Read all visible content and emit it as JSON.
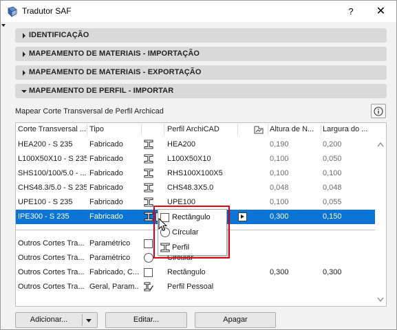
{
  "window": {
    "title": "Tradutor SAF",
    "help_label": "?",
    "close_label": "✕"
  },
  "sections": [
    {
      "label": "IDENTIFICAÇÃO",
      "expanded": false
    },
    {
      "label": "MAPEAMENTO DE MATERIAIS - IMPORTAÇÃO",
      "expanded": false
    },
    {
      "label": "MAPEAMENTO DE MATERIAIS - EXPORTAÇÃO",
      "expanded": false
    },
    {
      "label": "MAPEAMENTO DE PERFIL - IMPORTAR",
      "expanded": true
    }
  ],
  "panel": {
    "title": "Mapear Corte Transversal de Perfil Archicad",
    "info_icon": "info-icon"
  },
  "table": {
    "columns": [
      "Corte Transversal ...",
      "Tipo",
      "Perfil ArchiCAD",
      "Altura de N...",
      "Largura do ..."
    ],
    "rows": [
      {
        "section": "HEA200 - S 235",
        "type": "Fabricado",
        "icon": "i-beam-icon",
        "profile": "HEA200",
        "height": "0,190",
        "width": "0,200"
      },
      {
        "section": "L100X50X10 - S 235",
        "type": "Fabricado",
        "icon": "i-beam-icon",
        "profile": "L100X50X10",
        "height": "0,100",
        "width": "0,050"
      },
      {
        "section": "SHS100/100/5.0 - ...",
        "type": "Fabricado",
        "icon": "i-beam-icon",
        "profile": "RHS100X100X5",
        "height": "0,100",
        "width": "0,100"
      },
      {
        "section": "CHS48.3/5.0 - S 235",
        "type": "Fabricado",
        "icon": "i-beam-icon",
        "profile": "CHS48.3X5.0",
        "height": "0,048",
        "width": "0,048"
      },
      {
        "section": "UPE100 - S 235",
        "type": "Fabricado",
        "icon": "i-beam-icon",
        "profile": "UPE100",
        "height": "0,100",
        "width": "0,055"
      },
      {
        "section": "IPE300 - S 235",
        "type": "Fabricado",
        "icon": "i-beam-icon",
        "profile": "",
        "height": "0,300",
        "width": "0,150",
        "selected": true
      }
    ],
    "other_rows": [
      {
        "section": "Outros Cortes Tra...",
        "type": "Paramétrico",
        "icon": "square-icon",
        "profile": "",
        "height": "",
        "width": ""
      },
      {
        "section": "Outros Cortes Tra...",
        "type": "Paramétrico",
        "icon": "circle-icon",
        "profile": "Circular",
        "height": "",
        "width": ""
      },
      {
        "section": "Outros Cortes Tra...",
        "type": "Fabricado, C...",
        "icon": "square-icon",
        "profile": "Rectângulo",
        "height": "0,300",
        "width": "0,300"
      },
      {
        "section": "Outros Cortes Tra...",
        "type": "Geral, Param...",
        "icon": "custom-profile-icon",
        "profile": "Perfil Pessoal",
        "height": "",
        "width": ""
      }
    ]
  },
  "popup_menu": {
    "items": [
      {
        "label": "Rectângulo",
        "icon": "square-icon"
      },
      {
        "label": "Círcular",
        "icon": "circle-icon"
      },
      {
        "label": "Perfil",
        "icon": "i-beam-icon"
      }
    ],
    "highlight_color": "#e0000d"
  },
  "buttons": {
    "add": "Adicionar...",
    "edit": "Editar...",
    "delete": "Apagar"
  },
  "colors": {
    "selection": "#0a74d4",
    "section_bg": "#d9d9d9"
  }
}
